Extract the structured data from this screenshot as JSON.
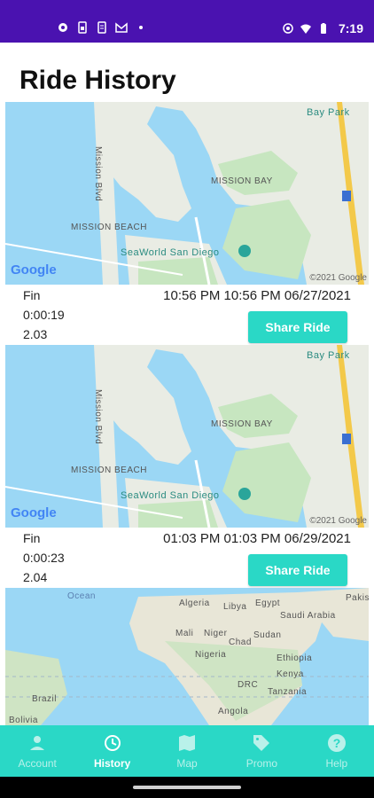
{
  "status_bar": {
    "time": "7:19",
    "left_icons": [
      "settings-icon",
      "sim-icon",
      "document-icon",
      "gmail-icon",
      "dot-icon"
    ],
    "right_icons": [
      "vpn-icon",
      "wifi-icon",
      "battery-icon"
    ]
  },
  "page": {
    "title": "Ride History"
  },
  "rides": [
    {
      "status": "Fin",
      "duration": "0:00:19",
      "distance": "2.03",
      "time_range": "10:56 PM 10:56 PM 06/27/2021",
      "share_label": "Share Ride",
      "map": {
        "labels": [
          "Mission Blvd",
          "MISSION BAY",
          "MISSION BEACH",
          "SeaWorld San Diego",
          "Bay Park"
        ],
        "google": "Google",
        "copyright": "©2021 Google"
      }
    },
    {
      "status": "Fin",
      "duration": "0:00:23",
      "distance": "2.04",
      "time_range": "01:03 PM 01:03 PM 06/29/2021",
      "share_label": "Share Ride",
      "map": {
        "labels": [
          "Mission Blvd",
          "MISSION BAY",
          "MISSION BEACH",
          "SeaWorld San Diego",
          "Bay Park"
        ],
        "google": "Google",
        "copyright": "©2021 Google"
      }
    }
  ],
  "world_map": {
    "labels": [
      "Ocean",
      "Algeria",
      "Libya",
      "Egypt",
      "Saudi Arabia",
      "Mali",
      "Niger",
      "Chad",
      "Sudan",
      "Nigeria",
      "Ethiopia",
      "Kenya",
      "DRC",
      "Tanzania",
      "Angola",
      "Brazil",
      "Bolivia",
      "Pakis"
    ]
  },
  "nav": {
    "items": [
      {
        "label": "Account",
        "icon": "account-icon",
        "active": false
      },
      {
        "label": "History",
        "icon": "history-icon",
        "active": true
      },
      {
        "label": "Map",
        "icon": "map-icon",
        "active": false
      },
      {
        "label": "Promo",
        "icon": "promo-tag-icon",
        "active": false
      },
      {
        "label": "Help",
        "icon": "help-icon",
        "active": false
      }
    ]
  },
  "colors": {
    "status_bar": "#4a12b0",
    "accent": "#2ad8c6",
    "water": "#9bd7f5",
    "land": "#e9ece4",
    "park": "#c7e6c0",
    "highway": "#f3c94a"
  }
}
